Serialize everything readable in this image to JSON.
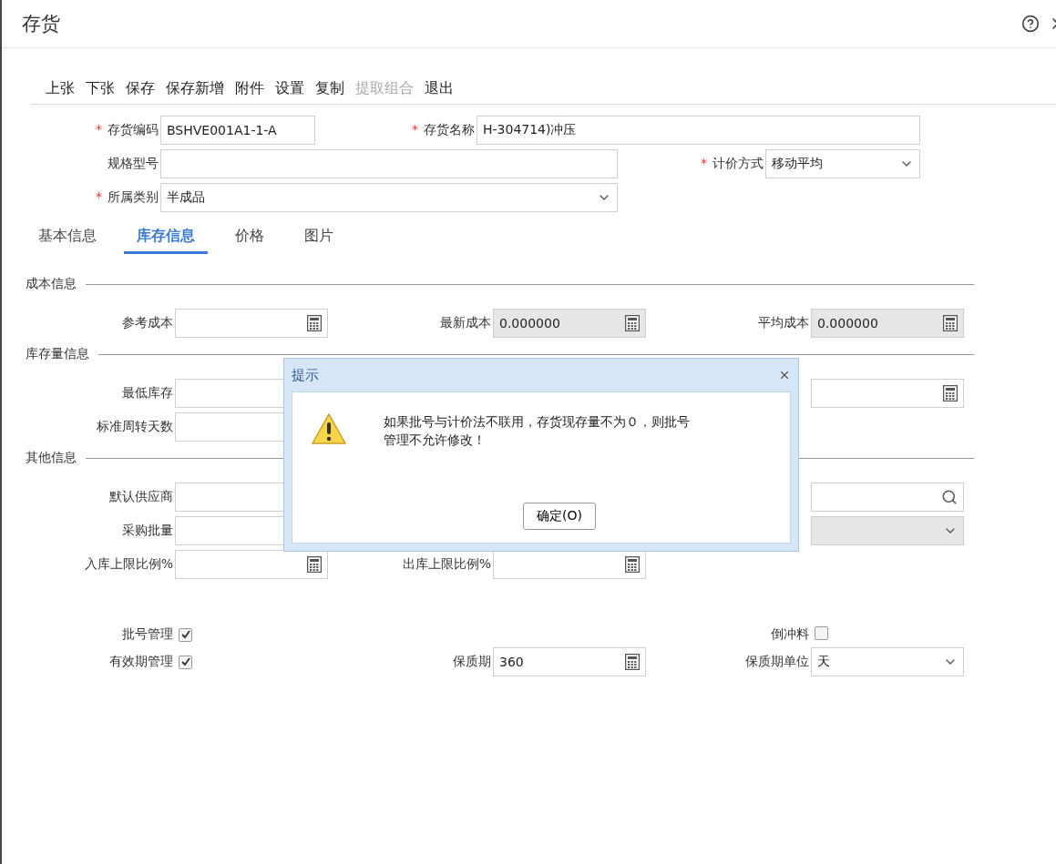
{
  "window": {
    "title": "存货"
  },
  "toolbar": [
    {
      "label": "上张",
      "disabled": false
    },
    {
      "label": "下张",
      "disabled": false
    },
    {
      "label": "保存",
      "disabled": false
    },
    {
      "label": "保存新增",
      "disabled": false
    },
    {
      "label": "附件",
      "disabled": false
    },
    {
      "label": "设置",
      "disabled": false
    },
    {
      "label": "复制",
      "disabled": false
    },
    {
      "label": "提取组合",
      "disabled": true
    },
    {
      "label": "退出",
      "disabled": false
    }
  ],
  "header_rows": [
    [
      {
        "mark": "*",
        "label": "存货编码",
        "kind": "text",
        "value": "BSHVE001A1-1-A"
      },
      {
        "mark": "*",
        "label": "存货名称",
        "kind": "text",
        "value": "H-304714)冲压"
      }
    ],
    [
      {
        "label": "规格型号",
        "kind": "text"
      },
      {
        "mark": "*",
        "label": "计价方式",
        "kind": "select",
        "value": "移动平均"
      }
    ],
    [
      {
        "mark": "*",
        "label": "所属类别",
        "kind": "select",
        "value": "半成品"
      }
    ]
  ],
  "tabs": [
    {
      "label": "基本信息",
      "selected": false
    },
    {
      "label": "库存信息",
      "selected": true
    },
    {
      "label": "价格",
      "selected": false
    },
    {
      "label": "图片",
      "selected": false
    }
  ],
  "sections": [
    {
      "title": "成本信息",
      "rows": [
        [
          {
            "label": "参考成本",
            "kind": "calc",
            "readonly": false
          },
          {
            "label": "最新成本",
            "kind": "calc",
            "value": "0.000000",
            "readonly": true
          },
          {
            "label": "平均成本",
            "kind": "calc",
            "value": "0.000000",
            "readonly": true
          }
        ]
      ]
    },
    {
      "title": "库存量信息",
      "rows": [
        [
          {
            "label": "最低库存",
            "kind": "text",
            "readonly": false
          },
          {
            "kind": "empty"
          },
          {
            "kind": "calc",
            "readonly": false
          }
        ],
        [
          {
            "label": "标准周转天数",
            "kind": "text",
            "readonly": false
          },
          {
            "kind": "empty"
          },
          {
            "kind": "empty"
          }
        ]
      ]
    },
    {
      "title": "其他信息",
      "rows": [
        [
          {
            "label": "默认供应商",
            "kind": "text",
            "readonly": false
          },
          {
            "kind": "empty"
          },
          {
            "kind": "search",
            "readonly": false
          }
        ],
        [
          {
            "label": "采购批量",
            "kind": "text",
            "readonly": false
          },
          {
            "kind": "empty"
          },
          {
            "kind": "select",
            "readonly": true
          }
        ],
        [
          {
            "label": "入库上限比例%",
            "kind": "calc",
            "readonly": false
          },
          {
            "label": "出库上限比例%",
            "kind": "calc",
            "readonly": false
          },
          {
            "kind": "empty"
          }
        ]
      ]
    }
  ],
  "flag_rows": [
    [
      {
        "label": "批号管理",
        "kind": "checkbox",
        "checked": true
      },
      {
        "kind": "empty"
      },
      {
        "label": "倒冲料",
        "kind": "checkbox",
        "checked": false
      }
    ],
    [
      {
        "label": "有效期管理",
        "kind": "checkbox",
        "checked": true
      },
      {
        "label": "保质期",
        "kind": "calc",
        "value": "360",
        "readonly": false
      },
      {
        "label": "保质期单位",
        "kind": "select",
        "value": "天",
        "readonly": false
      }
    ]
  ],
  "dialog": {
    "title": "提示",
    "message": "如果批号与计价法不联用，存货现存量不为０，则批号管理不允许修改！",
    "button": "确定(O)"
  }
}
